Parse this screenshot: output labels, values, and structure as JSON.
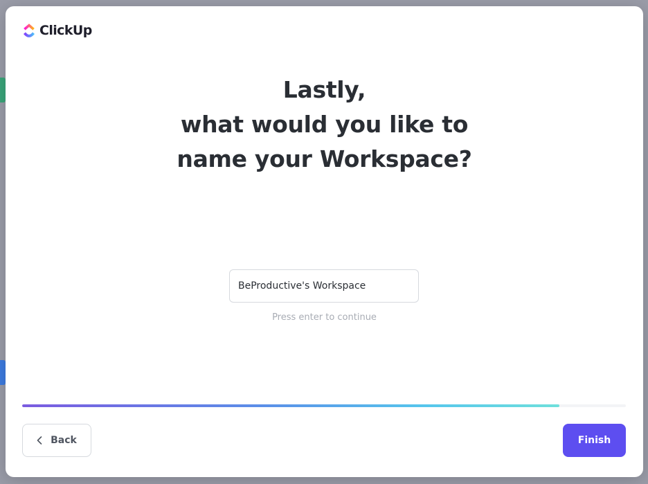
{
  "app": {
    "brand_name": "ClickUp",
    "logo_icon": "clickup-logo-icon"
  },
  "question": {
    "line1": "Lastly,",
    "line2": "what would you like to",
    "line3": "name your Workspace?"
  },
  "workspace_name": {
    "value": "BeProductive's Workspace",
    "hint": "Press enter to continue"
  },
  "progress": {
    "fraction": 0.89
  },
  "footer": {
    "back_label": "Back",
    "back_icon": "chevron-left-icon",
    "finish_label": "Finish"
  },
  "colors": {
    "primary": "#5d4ef0",
    "heading": "#2a2e34",
    "hint": "#a8acb4",
    "progress_start": "#7b5be0",
    "progress_end": "#6fe0dc"
  }
}
